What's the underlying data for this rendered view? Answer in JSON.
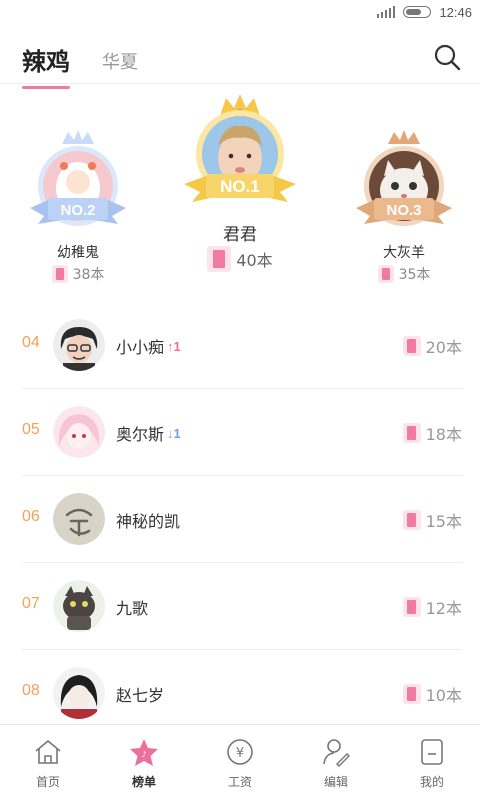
{
  "status_bar": {
    "time": "12:46"
  },
  "header": {
    "tabs": [
      {
        "label": "辣鸡",
        "active": true
      },
      {
        "label": "华夏",
        "active": false
      }
    ]
  },
  "podium": {
    "first": {
      "badge": "NO.1",
      "name": "君君",
      "count": "40本"
    },
    "second": {
      "badge": "NO.2",
      "name": "幼稚鬼",
      "count": "38本"
    },
    "third": {
      "badge": "NO.3",
      "name": "大灰羊",
      "count": "35本"
    }
  },
  "ranking": [
    {
      "rank": "04",
      "name": "小小痴",
      "trend": "↑1",
      "trend_dir": "up",
      "count": "20本"
    },
    {
      "rank": "05",
      "name": "奥尔斯",
      "trend": "↓1",
      "trend_dir": "down",
      "count": "18本"
    },
    {
      "rank": "06",
      "name": "神秘的凯",
      "trend": "",
      "trend_dir": "",
      "count": "15本"
    },
    {
      "rank": "07",
      "name": "九歌",
      "trend": "",
      "trend_dir": "",
      "count": "12本"
    },
    {
      "rank": "08",
      "name": "赵七岁",
      "trend": "",
      "trend_dir": "",
      "count": "10本"
    }
  ],
  "bottom_nav": [
    {
      "label": "首页",
      "icon": "home-icon",
      "active": false
    },
    {
      "label": "榜单",
      "icon": "star-icon",
      "active": true
    },
    {
      "label": "工资",
      "icon": "yen-coin-icon",
      "active": false
    },
    {
      "label": "编辑",
      "icon": "edit-icon",
      "active": false
    },
    {
      "label": "我的",
      "icon": "profile-icon",
      "active": false
    }
  ],
  "colors": {
    "accent_pink": "#f07aa0",
    "rank_orange": "#f0a35a",
    "gold": "#f5c84a",
    "silver_blue": "#a9c3ee",
    "bronze": "#e0a878"
  }
}
